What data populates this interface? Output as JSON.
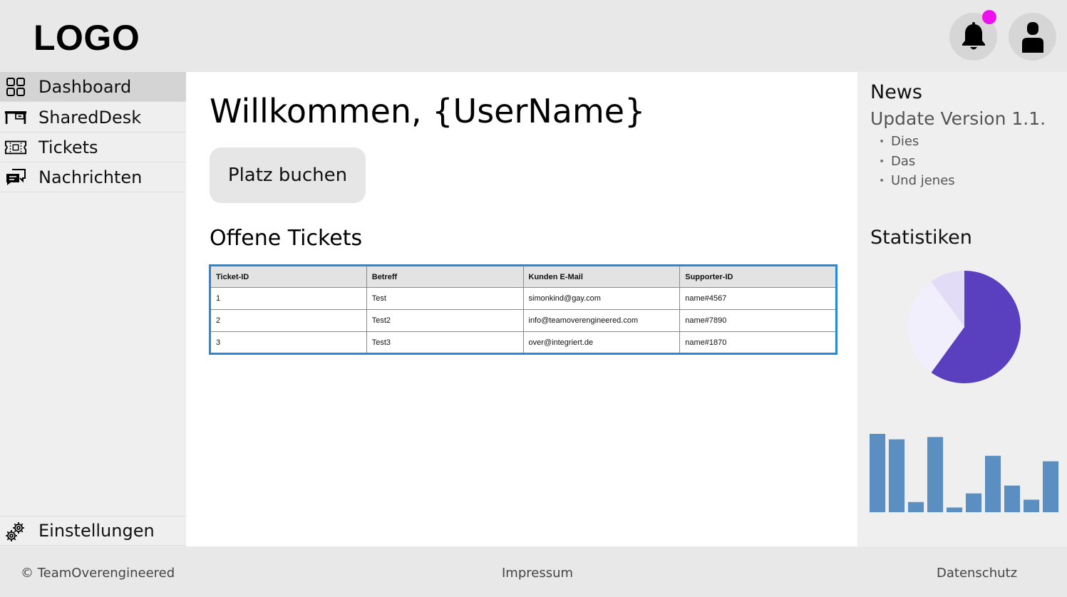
{
  "header": {
    "logo": "LOGO",
    "notification_dot_color": "#ee11ee",
    "icons": [
      "bell-icon",
      "user-icon"
    ]
  },
  "sidebar": {
    "items": [
      {
        "label": "Dashboard",
        "icon": "grid-icon",
        "active": true
      },
      {
        "label": "SharedDesk",
        "icon": "desk-icon",
        "active": false
      },
      {
        "label": "Tickets",
        "icon": "ticket-icon",
        "active": false
      },
      {
        "label": "Nachrichten",
        "icon": "chat-icon",
        "active": false
      }
    ],
    "settings": {
      "label": "Einstellungen",
      "icon": "gear-icon"
    }
  },
  "main": {
    "welcome": "Willkommen, {UserName}",
    "book_button": "Platz buchen",
    "tickets_title": "Offene Tickets",
    "table": {
      "border_color": "#2489dc",
      "columns": [
        "Ticket-ID",
        "Betreff",
        "Kunden E-Mail",
        "Supporter-ID"
      ],
      "rows": [
        [
          "1",
          "Test",
          "simonkind@gay.com",
          "name#4567"
        ],
        [
          "2",
          "Test2",
          "info@teamoverengineered.com",
          "name#7890"
        ],
        [
          "3",
          "Test3",
          "over@integriert.de",
          "name#1870"
        ]
      ]
    }
  },
  "news": {
    "title": "News",
    "subtitle": "Update Version 1.1.",
    "items": [
      "Dies",
      "Das",
      "Und jenes"
    ]
  },
  "stats": {
    "title": "Statistiken"
  },
  "chart_data": [
    {
      "type": "pie",
      "values": [
        60,
        30,
        10
      ],
      "colors": [
        "#5a3fbe",
        "#f2effc",
        "#e3dcf7"
      ]
    },
    {
      "type": "bar",
      "values": [
        100,
        93,
        13,
        96,
        6,
        24,
        72,
        34,
        16,
        65
      ],
      "ylim": [
        0,
        100
      ],
      "color": "#5b8fc2"
    }
  ],
  "footer": {
    "copyright": "© TeamOverengineered",
    "impressum": "Impressum",
    "datenschutz": "Datenschutz"
  }
}
